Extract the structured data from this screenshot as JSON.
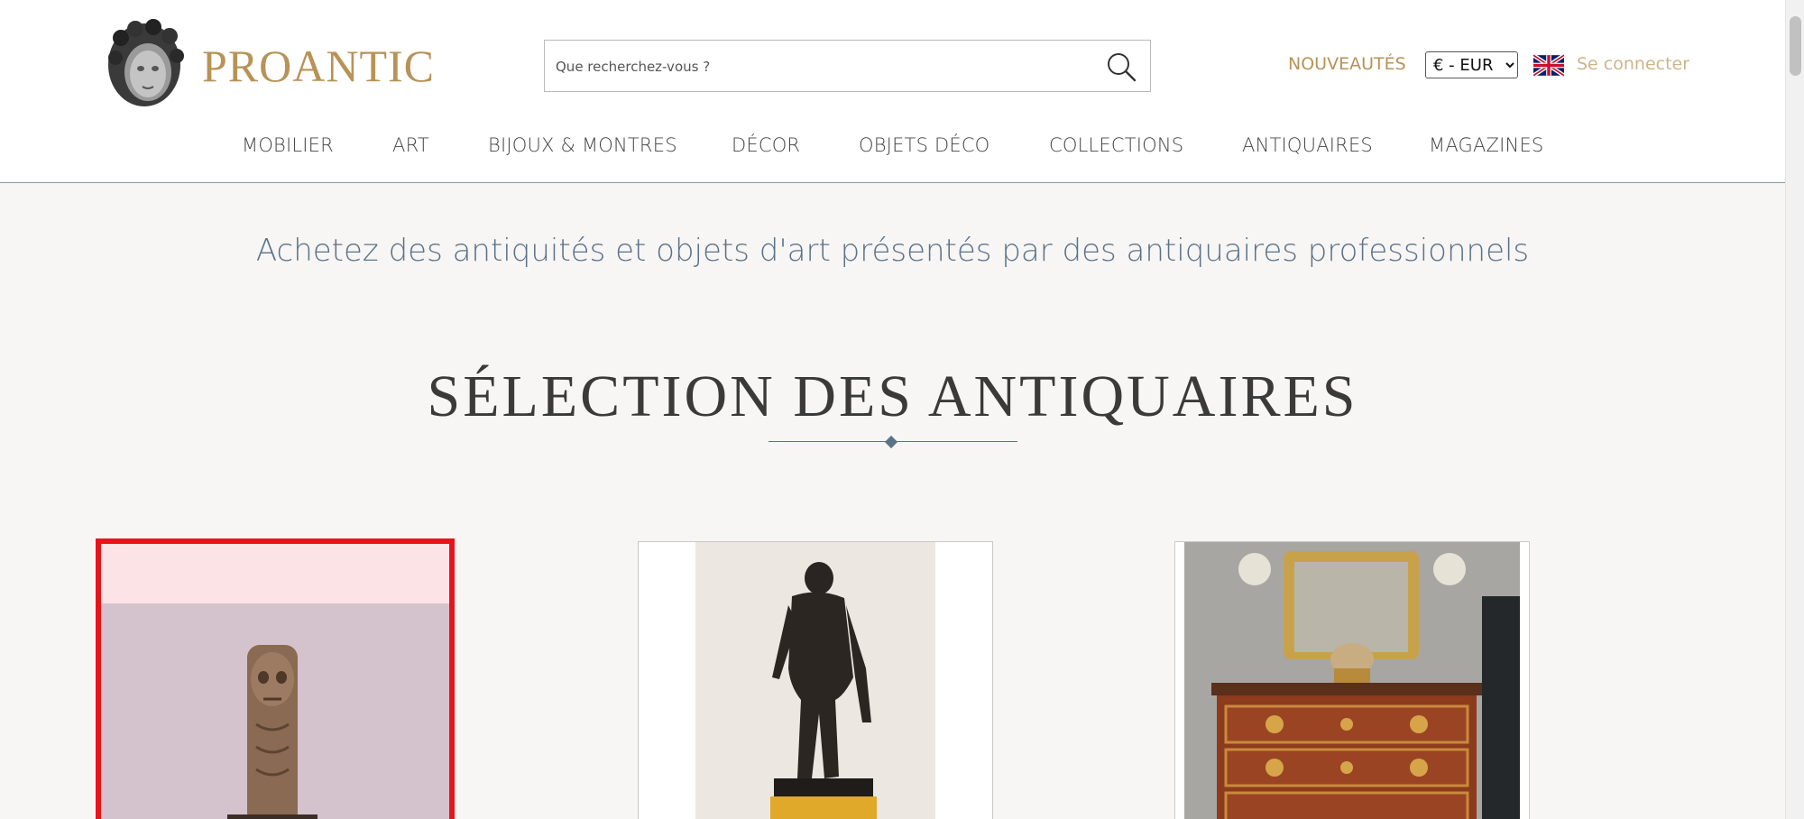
{
  "header": {
    "logo_text": "PROANTIC",
    "search_placeholder": "Que recherchez-vous ?",
    "nouveautes": "NOUVEAUTÉS",
    "currency_selected": "€ - EUR",
    "connect": "Se connecter"
  },
  "nav": [
    "MOBILIER",
    "ART",
    "BIJOUX & MONTRES",
    "DÉCOR",
    "OBJETS DÉCO",
    "COLLECTIONS",
    "ANTIQUAIRES",
    "MAGAZINES"
  ],
  "main": {
    "tagline": "Achetez des antiquités et objets d'art présentés par des antiquaires professionnels",
    "section_title": "SÉLECTION DES ANTIQUAIRES"
  },
  "colors": {
    "brand_gold": "#b89256",
    "nav_text": "#444444",
    "tagline_blue": "#5c7289",
    "selection_red": "#e8141c"
  },
  "icons": [
    "search-icon",
    "uk-flag-icon",
    "logo-head-icon"
  ]
}
